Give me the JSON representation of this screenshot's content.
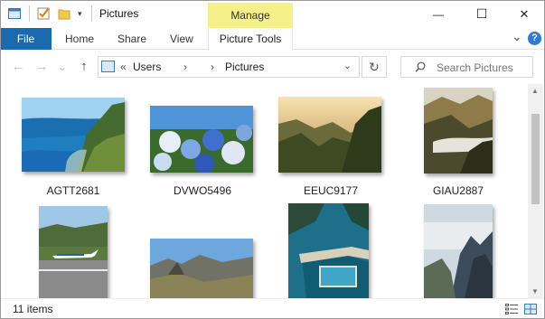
{
  "window": {
    "title": "Pictures",
    "manage_label": "Manage",
    "minimize": "—",
    "maximize": "☐",
    "close": "✕"
  },
  "ribbon": {
    "tabs": [
      "File",
      "Home",
      "Share",
      "View",
      "Picture Tools"
    ],
    "expand_glyph": "⌄",
    "help_glyph": "?"
  },
  "nav": {
    "back": "←",
    "forward": "→",
    "recent": "⌄",
    "up": "↑",
    "path_overflow": "«",
    "path": [
      "Users",
      "Pictures"
    ],
    "chevron": "›",
    "dropdown": "⌄",
    "refresh": "↻",
    "search_placeholder": "Search Pictures"
  },
  "files": [
    {
      "name": "AGTT2681",
      "icon": "coast-photo-icon"
    },
    {
      "name": "DVWO5496",
      "icon": "hydrangea-photo-icon"
    },
    {
      "name": "EEUC9177",
      "icon": "valley-sunset-photo-icon"
    },
    {
      "name": "GIAU2887",
      "icon": "mountain-clouds-photo-icon"
    },
    {
      "name": "",
      "icon": "airport-photo-icon"
    },
    {
      "name": "",
      "icon": "peak-photo-icon"
    },
    {
      "name": "",
      "icon": "pool-aerial-photo-icon"
    },
    {
      "name": "",
      "icon": "cliffs-photo-icon"
    }
  ],
  "status": {
    "item_count": "11 items"
  }
}
